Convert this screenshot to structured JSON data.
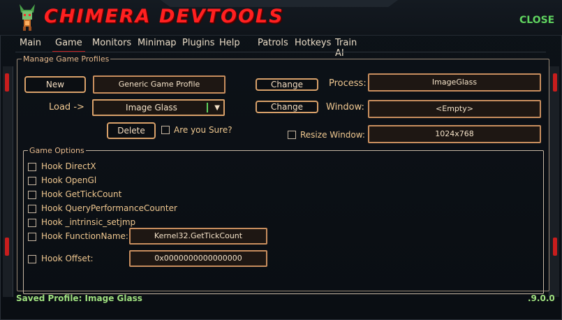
{
  "app": {
    "title": "CHIMERA DEVTOOLS",
    "close_label": "CLOSE"
  },
  "menu": [
    {
      "label": "Main"
    },
    {
      "label": "Game"
    },
    {
      "label": "Monitors"
    },
    {
      "label": "Minimap"
    },
    {
      "label": "Plugins"
    },
    {
      "label": "Help"
    },
    {
      "label": "Patrols"
    },
    {
      "label": "Hotkeys"
    },
    {
      "label": "Train AI"
    }
  ],
  "active_tab": "Game",
  "profiles": {
    "legend": "Manage Game Profiles",
    "new_label": "New",
    "profile_name": "Generic Game Profile",
    "load_label": "Load ->",
    "load_selected": "Image Glass",
    "delete_label": "Delete",
    "are_you_sure": "Are you Sure?",
    "change_label": "Change",
    "process_label": "Process:",
    "process_value": "ImageGlass",
    "window_label": "Window:",
    "window_value": "<Empty>",
    "resize_label": "Resize Window:",
    "resize_value": "1024x768"
  },
  "options": {
    "legend": "Game Options",
    "hooks": [
      {
        "label": "Hook DirectX"
      },
      {
        "label": "Hook OpenGl"
      },
      {
        "label": "Hook GetTickCount"
      },
      {
        "label": "Hook QueryPerformanceCounter"
      },
      {
        "label": "Hook _intrinsic_setjmp"
      },
      {
        "label": "Hook FunctionName:"
      },
      {
        "label": "Hook Offset:"
      }
    ],
    "function_name_value": "Kernel32.GetTickCount",
    "offset_value": "0x0000000000000000"
  },
  "footer": {
    "status": "Saved Profile: Image Glass",
    "version": ".9.0.0"
  },
  "colors": {
    "accent_red": "#c81d1d",
    "title_red": "#ff2020",
    "status_green": "#9fe07f",
    "border_orange": "#d9a16a"
  }
}
